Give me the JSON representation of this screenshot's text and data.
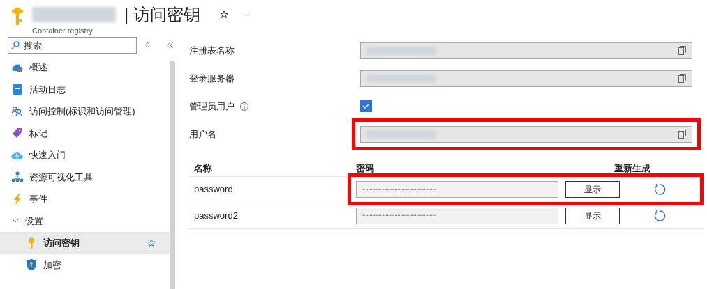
{
  "header": {
    "title_redacted": true,
    "title": "| 访问密钥",
    "subtitle": "Container registry",
    "more": "···"
  },
  "sidebar": {
    "search": {
      "placeholder": "搜索"
    },
    "items": [
      {
        "label": "概述",
        "kind": "cloud",
        "selected": false
      },
      {
        "label": "活动日志",
        "kind": "book",
        "selected": false
      },
      {
        "label": "访问控制(标识和访问管理)",
        "kind": "people",
        "selected": false
      },
      {
        "label": "标记",
        "kind": "tag",
        "selected": false
      },
      {
        "label": "快速入门",
        "kind": "cloudbolt",
        "selected": false
      },
      {
        "label": "资源可视化工具",
        "kind": "tree",
        "selected": false
      },
      {
        "label": "事件",
        "kind": "bolt",
        "selected": false
      },
      {
        "label": "设置",
        "expanded": true,
        "selected": false,
        "children": [
          {
            "label": "访问密钥",
            "kind": "key",
            "selected": true,
            "favorite": true
          },
          {
            "label": "加密",
            "kind": "shield",
            "selected": false,
            "favorite": false
          }
        ]
      }
    ]
  },
  "fields": [
    {
      "label": "注册表名称",
      "kind": "text",
      "redacted": true,
      "highlighted": false
    },
    {
      "label": "登录服务器",
      "kind": "text",
      "redacted": true,
      "highlighted": false
    },
    {
      "label": "管理员用户",
      "kind": "checkbox",
      "info": true,
      "checked": true
    },
    {
      "label": "用户名",
      "kind": "text",
      "redacted": true,
      "highlighted": true
    }
  ],
  "passwords": {
    "columns": [
      "名称",
      "密码",
      "重新生成"
    ],
    "rows": [
      {
        "name": "password",
        "value": "••••••••••••••••••••••••••••••••••••••••••••••••••",
        "button": "显示",
        "highlighted": true
      },
      {
        "name": "password2",
        "value": "••••••••••••••••••••••••••••••••••••••••••••••••••",
        "button": "显示",
        "highlighted": false
      }
    ]
  }
}
